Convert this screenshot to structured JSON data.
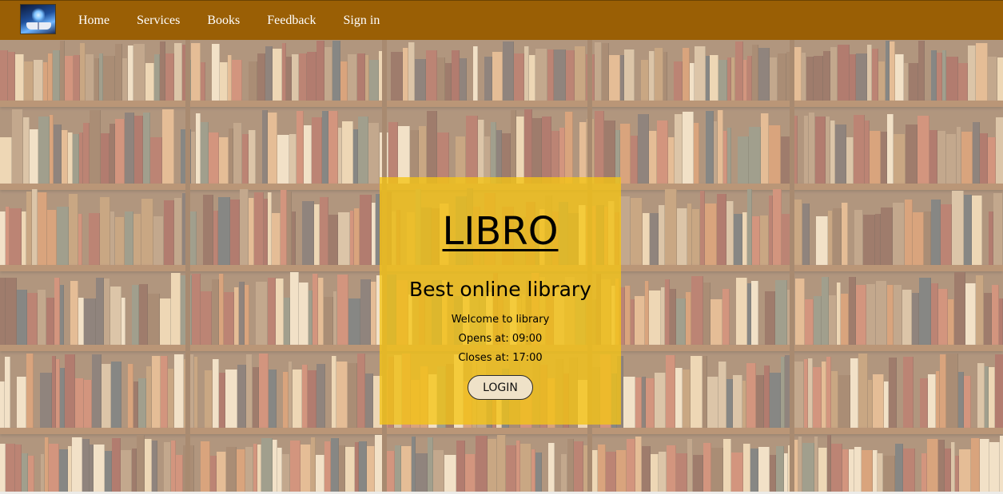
{
  "nav": {
    "logo_icon": "open-book-logo-icon",
    "links": [
      "Home",
      "Services",
      "Books",
      "Feedback",
      "Sign in"
    ]
  },
  "hero": {
    "background": "bookshelf-photo",
    "brand": "LIBRO",
    "tagline": "Best online library",
    "welcome": "Welcome to library",
    "opens": "Opens at: 09:00",
    "closes": "Closes at: 17:00",
    "login_label": "LOGIN"
  },
  "colors": {
    "navbar": "#9a5f05",
    "card": "#f5c414",
    "button": "#efe2c8"
  }
}
